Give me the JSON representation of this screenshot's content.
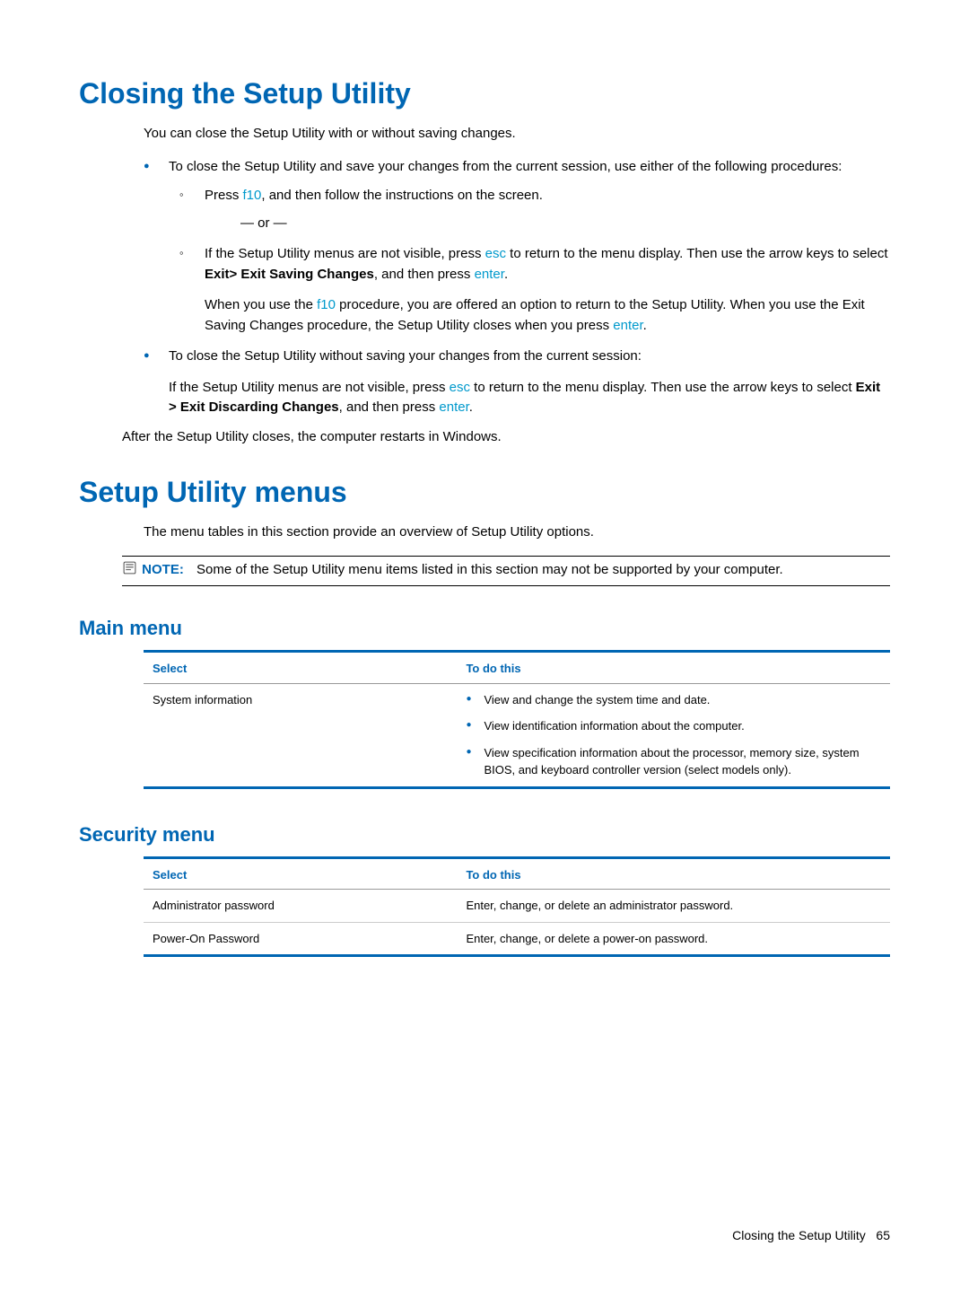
{
  "heading1": "Closing the Setup Utility",
  "section1": {
    "intro": "You can close the Setup Utility with or without saving changes.",
    "bullet1": "To close the Setup Utility and save your changes from the current session, use either of the following procedures:",
    "sub1_a": "Press ",
    "sub1_key": "f10",
    "sub1_b": ", and then follow the instructions on the screen.",
    "or": "— or —",
    "sub2_a": "If the Setup Utility menus are not visible, press ",
    "sub2_esc": "esc",
    "sub2_b": " to return to the menu display. Then use the arrow keys to select ",
    "sub2_bold": "Exit> Exit Saving Changes",
    "sub2_c": ", and then press ",
    "sub2_enter": "enter",
    "sub2_d": ".",
    "sub2_p2_a": "When you use the ",
    "sub2_p2_key": "f10",
    "sub2_p2_b": " procedure, you are offered an option to return to the Setup Utility. When you use the Exit Saving Changes procedure, the Setup Utility closes when you press ",
    "sub2_p2_enter": "enter",
    "sub2_p2_c": ".",
    "bullet2": "To close the Setup Utility without saving your changes from the current session:",
    "b2_p_a": "If the Setup Utility menus are not visible, press ",
    "b2_esc": "esc",
    "b2_p_b": " to return to the menu display. Then use the arrow keys to select ",
    "b2_bold": "Exit > Exit Discarding Changes",
    "b2_p_c": ", and then press ",
    "b2_enter": "enter",
    "b2_p_d": ".",
    "outro": "After the Setup Utility closes, the computer restarts in Windows."
  },
  "heading2": "Setup Utility menus",
  "section2": {
    "intro": "The menu tables in this section provide an overview of Setup Utility options.",
    "note_label": "NOTE:",
    "note_text": "Some of the Setup Utility menu items listed in this section may not be supported by your computer."
  },
  "main_menu": {
    "title": "Main menu",
    "col_select": "Select",
    "col_todo": "To do this",
    "row1_select": "System information",
    "row1_items": [
      "View and change the system time and date.",
      "View identification information about the computer.",
      "View specification information about the processor, memory size, system BIOS, and keyboard controller version (select models only)."
    ]
  },
  "security_menu": {
    "title": "Security menu",
    "col_select": "Select",
    "col_todo": "To do this",
    "rows": [
      {
        "select": "Administrator password",
        "todo": "Enter, change, or delete an administrator password."
      },
      {
        "select": "Power-On Password",
        "todo": "Enter, change, or delete a power-on password."
      }
    ]
  },
  "footer_text": "Closing the Setup Utility",
  "footer_page": "65"
}
